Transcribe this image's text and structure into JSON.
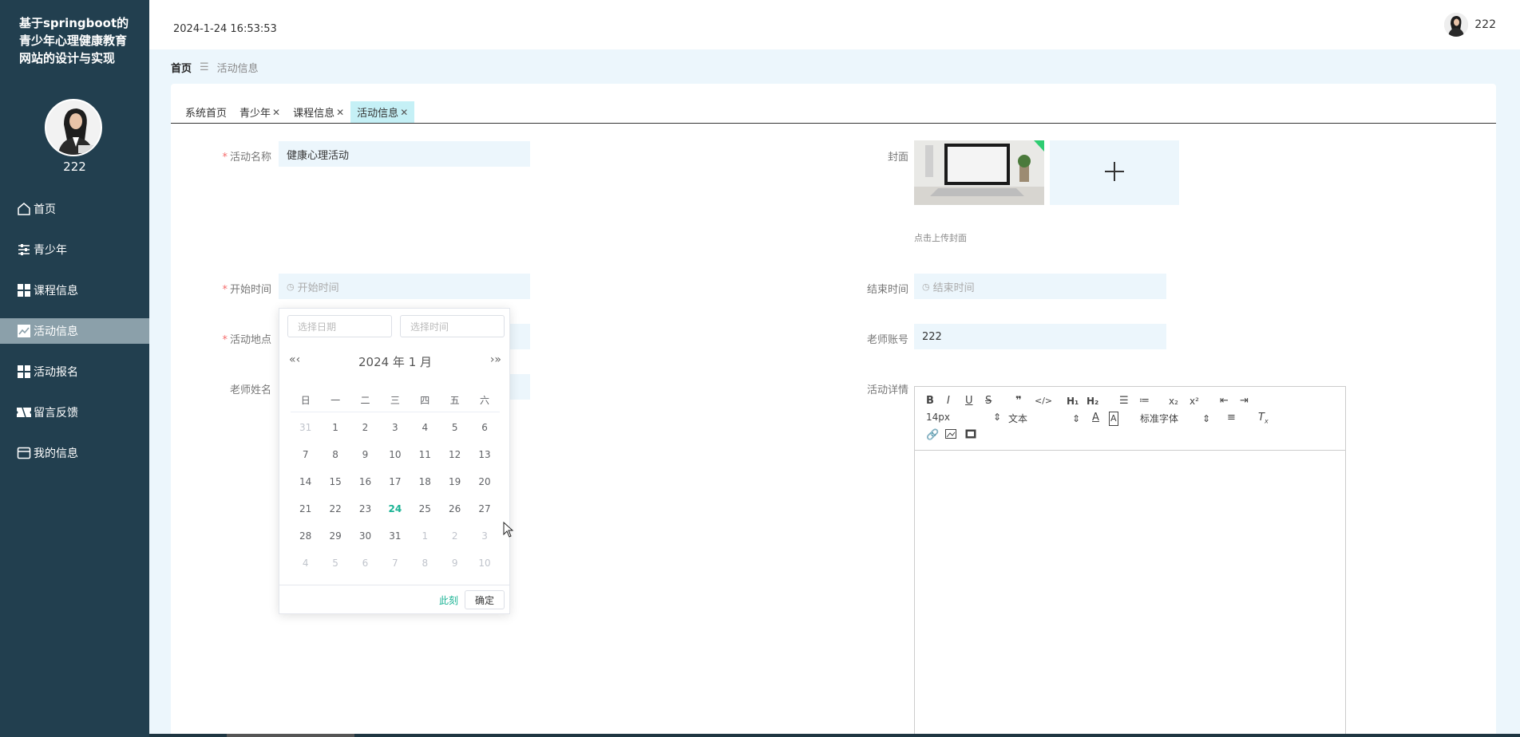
{
  "app": {
    "title": "基于springboot的青少年心理健康教育网站的设计与实现"
  },
  "sidebar": {
    "username": "222",
    "items": [
      {
        "label": "首页",
        "icon": "home-icon"
      },
      {
        "label": "青少年",
        "icon": "sliders-icon"
      },
      {
        "label": "课程信息",
        "icon": "grid-icon"
      },
      {
        "label": "活动信息",
        "icon": "chart-icon",
        "active": true
      },
      {
        "label": "活动报名",
        "icon": "grid-icon"
      },
      {
        "label": "留言反馈",
        "icon": "ticket-icon"
      },
      {
        "label": "我的信息",
        "icon": "card-icon"
      }
    ]
  },
  "header": {
    "datetime": "2024-1-24 16:53:53",
    "username": "222"
  },
  "breadcrumb": {
    "home": "首页",
    "current": "活动信息"
  },
  "tabs": [
    {
      "label": "系统首页",
      "closable": false
    },
    {
      "label": "青少年",
      "closable": true
    },
    {
      "label": "课程信息",
      "closable": true
    },
    {
      "label": "活动信息",
      "closable": true,
      "active": true
    }
  ],
  "form": {
    "name_label": "活动名称",
    "name_value": "健康心理活动",
    "cover_label": "封面",
    "cover_tip": "点击上传封面",
    "start_label": "开始时间",
    "start_placeholder": "开始时间",
    "end_label": "结束时间",
    "end_placeholder": "结束时间",
    "location_label": "活动地点",
    "teacher_account_label": "老师账号",
    "teacher_account_value": "222",
    "teacher_name_label": "老师姓名",
    "detail_label": "活动详情"
  },
  "datepicker": {
    "date_placeholder": "选择日期",
    "time_placeholder": "选择时间",
    "title": "2024 年  1 月",
    "weekdays": [
      "日",
      "一",
      "二",
      "三",
      "四",
      "五",
      "六"
    ],
    "weeks": [
      [
        "31",
        "1",
        "2",
        "3",
        "4",
        "5",
        "6"
      ],
      [
        "7",
        "8",
        "9",
        "10",
        "11",
        "12",
        "13"
      ],
      [
        "14",
        "15",
        "16",
        "17",
        "18",
        "19",
        "20"
      ],
      [
        "21",
        "22",
        "23",
        "24",
        "25",
        "26",
        "27"
      ],
      [
        "28",
        "29",
        "30",
        "31",
        "1",
        "2",
        "3"
      ],
      [
        "4",
        "5",
        "6",
        "7",
        "8",
        "9",
        "10"
      ]
    ],
    "today": "24",
    "now_label": "此刻",
    "ok_label": "确定"
  },
  "editor": {
    "font_size": "14px",
    "block_type": "文本",
    "font_family": "标准字体"
  },
  "colors": {
    "sidebar_bg": "#223f4f",
    "active_menu": "#8ba0aa",
    "accent": "#1ab394",
    "input_bg": "#ecf6fc",
    "tab_active": "#c5f0f6"
  }
}
